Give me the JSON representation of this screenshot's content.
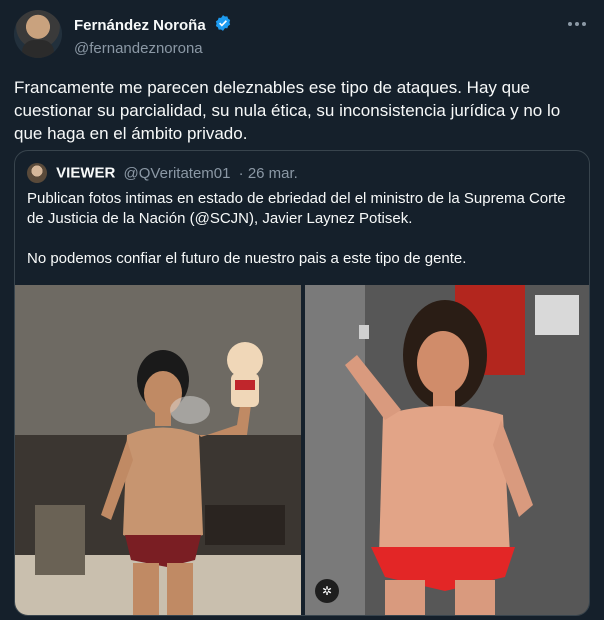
{
  "author": {
    "display_name": "Fernández Noroña",
    "handle": "@fernandeznorona"
  },
  "tweet": {
    "text": "Francamente me parecen deleznables ese tipo de ataques. Hay que cuestionar su parcialidad, su nula ética, su inconsistencia jurídica y no lo que haga en el ámbito privado."
  },
  "quoted": {
    "display_name": "VIEWER",
    "handle": "@QVeritatem01",
    "date": "· 26 mar.",
    "paragraph1": "Publican fotos intimas en estado de ebriedad del el ministro de la Suprema Corte de Justicia de la Nación (@SCJN), Javier Laynez Potisek.",
    "paragraph2": "No podemos confiar el futuro de nuestro pais a este tipo de gente."
  },
  "icons": {
    "verified": "verified-badge-icon",
    "more": "more-options-icon",
    "media": "media-expand-icon"
  },
  "colors": {
    "background": "#15202b",
    "text": "#f7f9f9",
    "secondary": "#8b98a5",
    "verified": "#1d9bf0",
    "border": "#38444d"
  }
}
